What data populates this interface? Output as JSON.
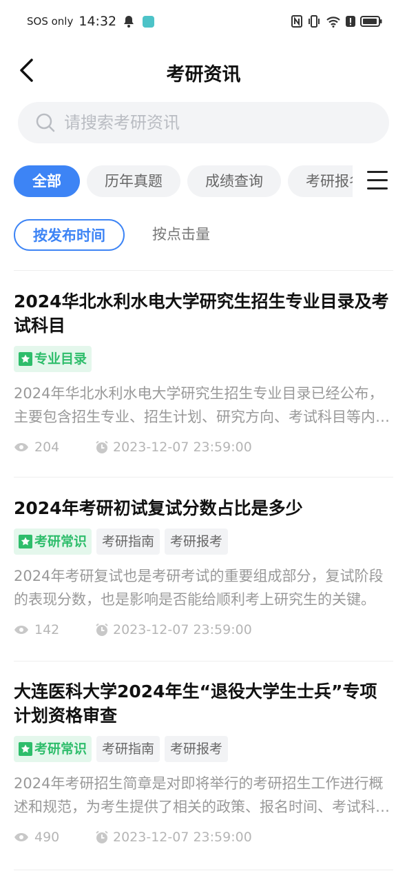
{
  "status_bar": {
    "carrier": "SOS only",
    "time": "14:32"
  },
  "header": {
    "title": "考研资讯"
  },
  "search": {
    "placeholder": "请搜索考研资讯"
  },
  "category_tabs": [
    {
      "label": "全部",
      "active": true
    },
    {
      "label": "历年真题",
      "active": false
    },
    {
      "label": "成绩查询",
      "active": false
    },
    {
      "label": "考研报名",
      "active": false
    }
  ],
  "sort": {
    "options": [
      "按发布时间",
      "按点击量"
    ],
    "active": "按发布时间"
  },
  "articles": [
    {
      "title": "2024华北水利水电大学研究生招生专业目录及考试科目",
      "tags": [
        "专业目录"
      ],
      "summary": "2024年华北水利水电大学研究生招生专业目录已经公布，主要包含招生专业、招生计划、研究方向、考试科目等内容。",
      "views": "204",
      "date": "2023-12-07 23:59:00"
    },
    {
      "title": "2024年考研初试复试分数占比是多少",
      "tags": [
        "考研常识",
        "考研指南",
        "考研报考"
      ],
      "summary": "2024年考研复试也是考研考试的重要组成部分，复试阶段的表现分数，也是影响是否能给顺利考上研究生的关键。",
      "views": "142",
      "date": "2023-12-07 23:59:00"
    },
    {
      "title": "大连医科大学2024年生“退役大学生士兵”专项计划资格审查",
      "tags": [
        "考研常识",
        "考研指南",
        "考研报考"
      ],
      "summary": "2024年考研招生简章是对即将举行的考研招生工作进行概述和规范，为考生提供了相关的政策、报名时间、考试科目等信息。",
      "views": "490",
      "date": "2023-12-07 23:59:00"
    }
  ],
  "colors": {
    "accent": "#3d84f5",
    "tag_green": "#2ebd6b",
    "tag_green_bg": "#e4f7ec"
  }
}
